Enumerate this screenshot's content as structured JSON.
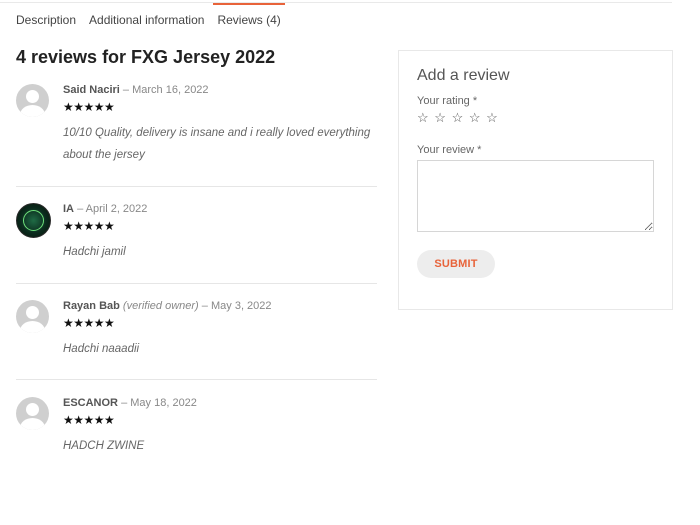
{
  "tabs": [
    {
      "label": "Description"
    },
    {
      "label": "Additional information"
    },
    {
      "label": "Reviews (4)"
    }
  ],
  "reviews_heading": "4 reviews for FXG Jersey 2022",
  "reviews": [
    {
      "author": "Said Naciri",
      "verified": "",
      "sep": "–",
      "date": "March 16, 2022",
      "rating": 5,
      "stars": "★★★★★",
      "text": "10/10 Quality, delivery is insane and i really loved everything about the jersey",
      "avatar": "default-avatar"
    },
    {
      "author": "IA",
      "verified": "",
      "sep": "–",
      "date": "April 2, 2022",
      "rating": 5,
      "stars": "★★★★★",
      "text": "Hadchi jamil",
      "avatar": "custom-avatar"
    },
    {
      "author": "Rayan Bab",
      "verified": "(verified owner)",
      "sep": "–",
      "date": "May 3, 2022",
      "rating": 5,
      "stars": "★★★★★",
      "text": "Hadchi naaadii",
      "avatar": "default-avatar"
    },
    {
      "author": "ESCANOR",
      "verified": "",
      "sep": "–",
      "date": "May 18, 2022",
      "rating": 5,
      "stars": "★★★★★",
      "text": "HADCH ZWINE",
      "avatar": "default-avatar"
    }
  ],
  "form": {
    "title": "Add a review",
    "rating_label": "Your rating *",
    "rating_stars": [
      "☆",
      "☆",
      "☆",
      "☆",
      "☆"
    ],
    "review_label": "Your review *",
    "submit_label": "SUBMIT"
  },
  "colors": {
    "accent": "#e8633a",
    "star": "#111111"
  }
}
